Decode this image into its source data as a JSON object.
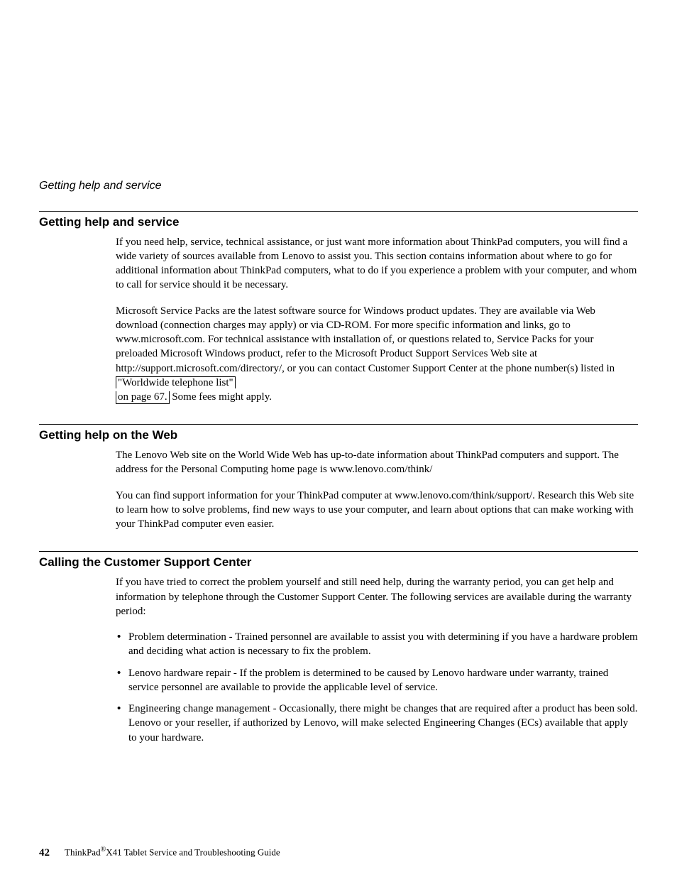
{
  "running_head": "Getting help and service",
  "sections": [
    {
      "heading": "Getting help and service",
      "paragraphs": [
        "If you need help, service, technical assistance, or just want more information about ThinkPad computers, you will find a wide variety of sources available from Lenovo to assist you. This section contains information about where to go for additional information about ThinkPad computers, what to do if you experience a problem with your computer, and whom to call for service should it be necessary.",
        {
          "pre": "Microsoft Service Packs are the latest software source for Windows product updates. They are available via Web download (connection charges may apply) or via CD-ROM. For more specific information and links, go to www.microsoft.com. For technical assistance with installation of, or questions related to, Service Packs for your preloaded Microsoft Windows product, refer to the Microsoft Product Support Services Web site at http://support.microsoft.com/directory/, or you can contact Customer Support Center at the phone number(s) listed in ",
          "xref1": "\"Worldwide telephone list\"",
          "xref2": "on page 67.",
          "post": " Some fees might apply."
        }
      ]
    },
    {
      "heading": "Getting help on the Web",
      "paragraphs": [
        "The Lenovo Web site on the World Wide Web has up-to-date information about ThinkPad computers and support. The address for the Personal Computing home page is www.lenovo.com/think/",
        "You can find support information for your ThinkPad computer at www.lenovo.com/think/support/. Research this Web site to learn how to solve problems, find new ways to use your computer, and learn about options that can make working with your ThinkPad computer even easier."
      ]
    },
    {
      "heading": "Calling the Customer Support Center",
      "intro": "If you have tried to correct the problem yourself and still need help, during the warranty period, you can get help and information by telephone through the Customer Support Center. The following services are available during the warranty period:",
      "bullets": [
        "Problem determination - Trained personnel are available to assist you with determining if you have a hardware problem and deciding what action is necessary to fix the problem.",
        "Lenovo hardware repair - If the problem is determined to be caused by Lenovo hardware under warranty, trained service personnel are available to provide the applicable level of service.",
        "Engineering change management - Occasionally, there might be changes that are required after a product has been sold. Lenovo or your reseller, if authorized by Lenovo, will make selected Engineering Changes (ECs) available that apply to your hardware."
      ]
    }
  ],
  "footer": {
    "page_number": "42",
    "brand": "ThinkPad",
    "trademark": "®",
    "title_rest": "X41 Tablet Service and Troubleshooting Guide"
  }
}
